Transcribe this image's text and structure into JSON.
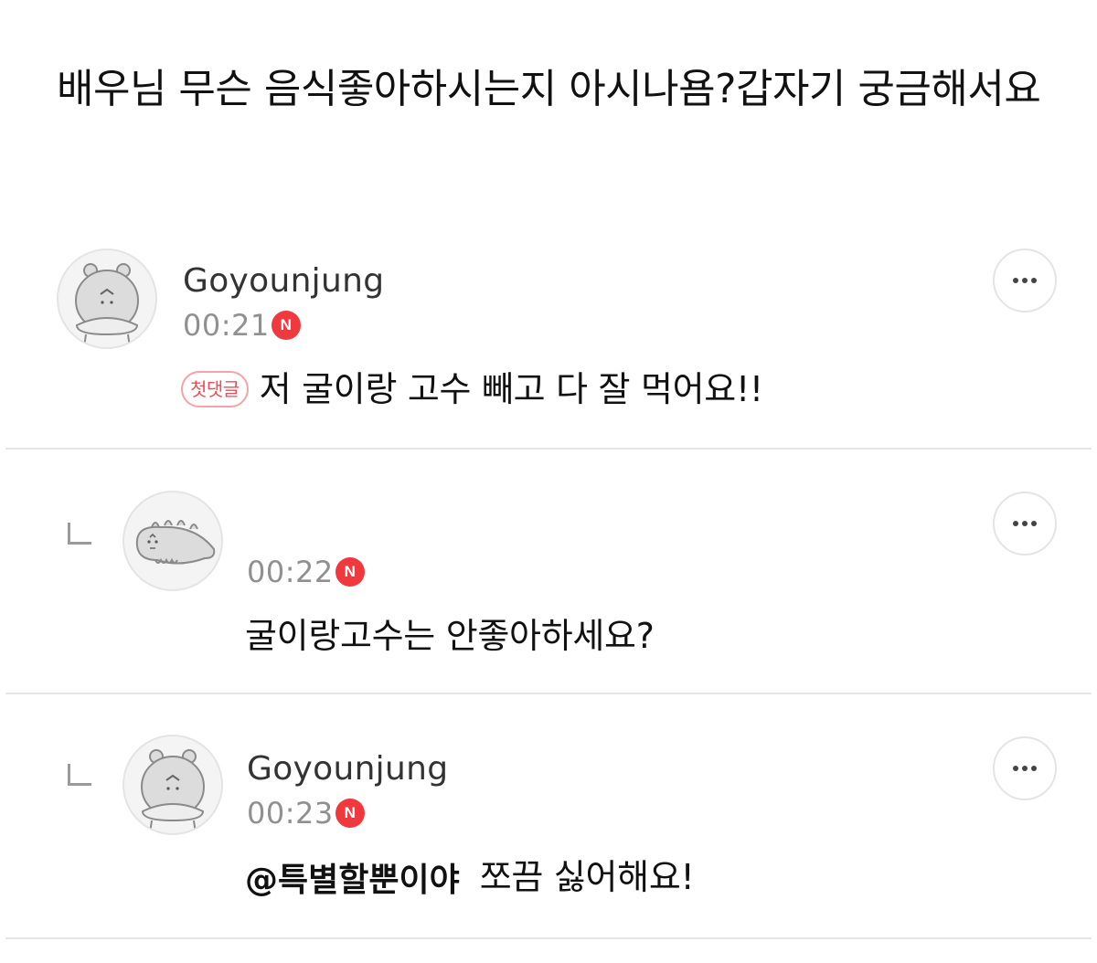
{
  "post": {
    "title": "배우님 무슨 음식좋아하시는지 아시나욤?갑자기 궁금해서요"
  },
  "comments": [
    {
      "author": "Goyounjung",
      "time": "00:21",
      "new_badge": "N",
      "first_comment_badge": "첫댓글",
      "text": "저 굴이랑 고수 빼고 다 잘 먹어요!!",
      "avatar_icon": "hippo-avatar-icon",
      "is_reply": false
    },
    {
      "author": "",
      "time": "00:22",
      "new_badge": "N",
      "text": "굴이랑고수는 안좋아하세요?",
      "avatar_icon": "dinosaur-avatar-icon",
      "is_reply": true
    },
    {
      "author": "Goyounjung",
      "time": "00:23",
      "new_badge": "N",
      "mention": "@특별할뿐이야",
      "text": "쪼끔 싫어해요!",
      "avatar_icon": "hippo-avatar-icon",
      "is_reply": true
    }
  ],
  "colors": {
    "new_badge": "#f0393e",
    "first_badge_text": "#ec4d56",
    "first_badge_border": "#f4a3a8",
    "divider": "#e6e6e6",
    "time_text": "#909090"
  }
}
